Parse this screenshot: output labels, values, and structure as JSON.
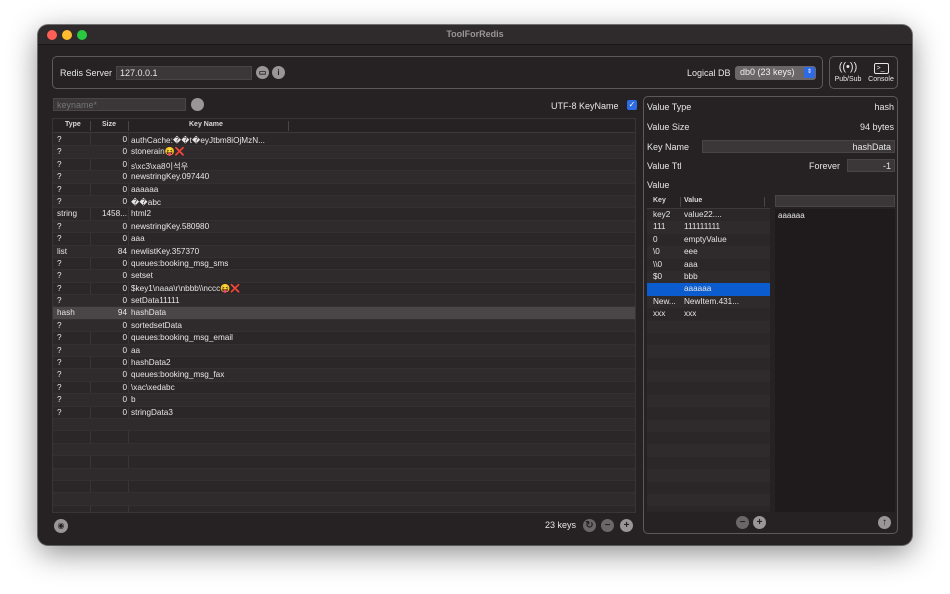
{
  "window": {
    "title": "ToolForRedis"
  },
  "server": {
    "label": "Redis Server",
    "host": "127.0.0.1",
    "open_icon": "folder-icon",
    "info_icon": "info-icon"
  },
  "db": {
    "label": "Logical DB",
    "selected": "db0 (23 keys)"
  },
  "tools": {
    "pubsub_label": "Pub/Sub",
    "console_label": "Console"
  },
  "search": {
    "placeholder": "keyname*",
    "utf8_label": "UTF-8 KeyName",
    "utf8_checked": true
  },
  "key_table": {
    "columns": [
      "Type",
      "Size",
      "Key Name"
    ],
    "rows": [
      {
        "type": "?",
        "size": "0",
        "name": "authCache:��t�eyJtbm8iOjMzN..."
      },
      {
        "type": "?",
        "size": "0",
        "name": "stonerain😝❌"
      },
      {
        "type": "?",
        "size": "0",
        "name": "s\\xc3\\xa8이석우"
      },
      {
        "type": "?",
        "size": "0",
        "name": "newstringKey.097440"
      },
      {
        "type": "?",
        "size": "0",
        "name": "aaaaaa"
      },
      {
        "type": "?",
        "size": "0",
        "name": "��abc"
      },
      {
        "type": "string",
        "size": "1458...",
        "name": "html2"
      },
      {
        "type": "?",
        "size": "0",
        "name": "newstringKey.580980"
      },
      {
        "type": "?",
        "size": "0",
        "name": "aaa"
      },
      {
        "type": "list",
        "size": "84",
        "name": "newlistKey.357370"
      },
      {
        "type": "?",
        "size": "0",
        "name": "queues:booking_msg_sms"
      },
      {
        "type": "?",
        "size": "0",
        "name": "setset"
      },
      {
        "type": "?",
        "size": "0",
        "name": "$key1\\naaa\\r\\nbbb\\\\nccc😝❌"
      },
      {
        "type": "?",
        "size": "0",
        "name": "setData11111"
      },
      {
        "type": "hash",
        "size": "94",
        "name": "hashData"
      },
      {
        "type": "?",
        "size": "0",
        "name": "sortedsetData"
      },
      {
        "type": "?",
        "size": "0",
        "name": "queues:booking_msg_email"
      },
      {
        "type": "?",
        "size": "0",
        "name": "aa"
      },
      {
        "type": "?",
        "size": "0",
        "name": "hashData2"
      },
      {
        "type": "?",
        "size": "0",
        "name": "queues:booking_msg_fax"
      },
      {
        "type": "?",
        "size": "0",
        "name": "\\xac\\xedabc"
      },
      {
        "type": "?",
        "size": "0",
        "name": "b"
      },
      {
        "type": "?",
        "size": "0",
        "name": "stringData3"
      }
    ],
    "selected_index": 14,
    "footer_count": "23 keys"
  },
  "value_panel": {
    "type_label": "Value Type",
    "type_value": "hash",
    "size_label": "Value Size",
    "size_value": "94 bytes",
    "name_label": "Key Name",
    "name_value": "hashData",
    "ttl_label": "Value Ttl",
    "ttl_forever": "Forever",
    "ttl_value": "-1",
    "value_label": "Value",
    "hash_columns": [
      "Key",
      "Value"
    ],
    "hash_rows": [
      {
        "key": "key2",
        "value": "value22...."
      },
      {
        "key": "111",
        "value": "111111111"
      },
      {
        "key": "0",
        "value": "emptyValue"
      },
      {
        "key": "\\0",
        "value": "eee"
      },
      {
        "key": "\\\\0",
        "value": "aaa"
      },
      {
        "key": "$0",
        "value": "bbb"
      },
      {
        "key": "",
        "value": "aaaaaa"
      },
      {
        "key": "New...",
        "value": "NewItem.431..."
      },
      {
        "key": "xxx",
        "value": "xxx"
      }
    ],
    "hash_selected_index": 6,
    "edited_value": "aaaaaa"
  },
  "colors": {
    "accent": "#2d6ae3",
    "selection": "#0b5ccf",
    "background": "#262122"
  }
}
